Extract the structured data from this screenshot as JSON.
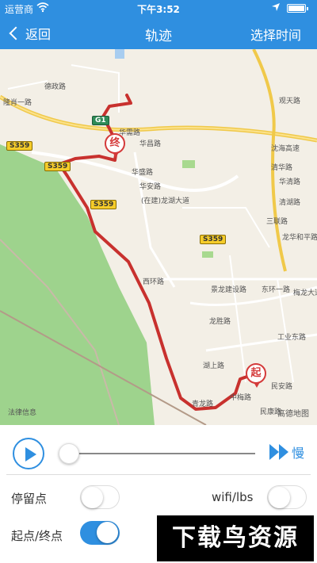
{
  "status_bar": {
    "carrier": "运营商",
    "time": "下午3:52",
    "battery_level": 1.0
  },
  "nav": {
    "back_label": "返回",
    "title": "轨迹",
    "select_time_label": "选择时间"
  },
  "map": {
    "labels": {
      "label_1": "德政路",
      "label_2": "隆肖一路",
      "label_3": "华需路",
      "label_4": "华昌路",
      "label_5": "华盛路",
      "label_6": "华安路",
      "label_7": "(在建)龙湖大道",
      "label_8": "西环路",
      "label_9": "龙胜路",
      "label_10": "景龙建设路",
      "label_11": "东环一路",
      "label_12": "观天路",
      "label_13": "沈海高速",
      "label_14": "清华路",
      "label_15": "华清路",
      "label_16": "清湖路",
      "label_17": "三联路",
      "label_18": "龙华和平路",
      "label_19": "梅龙大道",
      "label_20": "工业东路",
      "label_21": "中梅路",
      "label_22": "民安路",
      "label_23": "湖上路",
      "label_24": "民康路",
      "label_25": "青龙路"
    },
    "highways": [
      "S359",
      "S359",
      "S359",
      "S359",
      "G1"
    ],
    "start_pin": "起",
    "end_pin": "终",
    "footer_left": "法律信息",
    "footer_right": "高德地图"
  },
  "playback": {
    "progress": 0.0,
    "speed_label": "慢"
  },
  "settings": {
    "stop_point_label": "停留点",
    "stop_point_on": false,
    "wifi_lbs_label": "wifi/lbs",
    "wifi_lbs_on": false,
    "start_end_label": "起点/终点",
    "start_end_on": true
  },
  "watermark": "下载鸟资源",
  "colors": {
    "accent": "#2f8fe0",
    "track": "#c8312e",
    "highway": "#f5cc2a"
  }
}
